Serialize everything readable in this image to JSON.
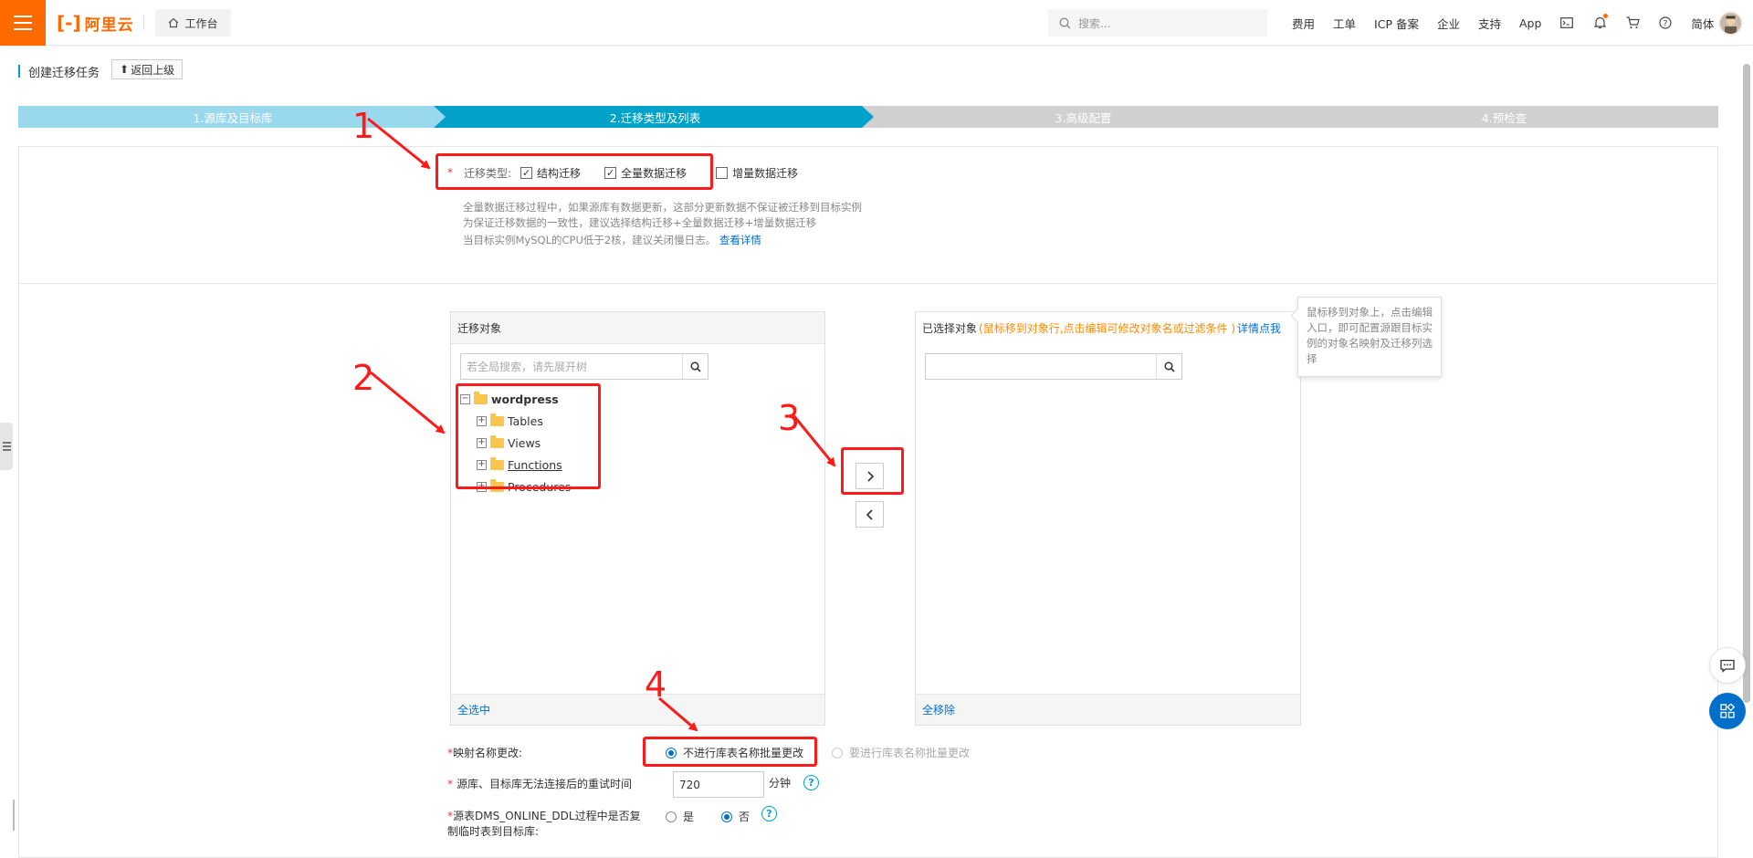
{
  "brand": {
    "logo_text": "阿里云",
    "accent": "#ff6a00"
  },
  "header": {
    "workbench_label": "工作台",
    "search_placeholder": "搜索...",
    "links": [
      "费用",
      "工单",
      "ICP 备案",
      "企业",
      "支持",
      "App"
    ],
    "lang": "简体"
  },
  "page": {
    "title": "创建迁移任务",
    "back_label": "返回上级"
  },
  "steps": [
    "1.源库及目标库",
    "2.迁移类型及列表",
    "3.高级配置",
    "4.预检查"
  ],
  "migration_type": {
    "label": "迁移类型:",
    "options": [
      {
        "label": "结构迁移",
        "checked": true
      },
      {
        "label": "全量数据迁移",
        "checked": true
      },
      {
        "label": "增量数据迁移",
        "checked": false
      }
    ],
    "desc_line1": "全量数据迁移过程中，如果源库有数据更新，这部分更新数据不保证被迁移到目标实例",
    "desc_line2": "为保证迁移数据的一致性，建议选择结构迁移+全量数据迁移+增量数据迁移",
    "desc_line3": "当目标实例MySQL的CPU低于2核，建议关闭慢日志。",
    "desc_link": "查看详情"
  },
  "source_list": {
    "title": "迁移对象",
    "search_placeholder": "若全局搜索，请先展开树",
    "root": "wordpress",
    "children": [
      "Tables",
      "Views",
      "Functions",
      "Procedures"
    ],
    "footer": "全选中"
  },
  "selected_list": {
    "title": "已选择对象",
    "hint": "(鼠标移到对象行,点击编辑可修改对象名或过滤条件 )",
    "link": "详情点我",
    "footer": "全移除",
    "tooltip": "鼠标移到对象上，点击编辑入口，即可配置源跟目标实例的对象名映射及迁移列选择"
  },
  "form": {
    "mapping_label": "映射名称更改:",
    "mapping_opt1": "不进行库表名称批量更改",
    "mapping_opt2": "要进行库表名称批量更改",
    "retry_label": "源库、目标库无法连接后的重试时间",
    "retry_value": "720",
    "retry_unit": "分钟",
    "ddl_label_line1": "源表DMS_ONLINE_DDL过程中是否复",
    "ddl_label_line2": "制临时表到目标库:",
    "ddl_yes": "是",
    "ddl_no": "否"
  },
  "annotations": [
    "1",
    "2",
    "3",
    "4"
  ]
}
